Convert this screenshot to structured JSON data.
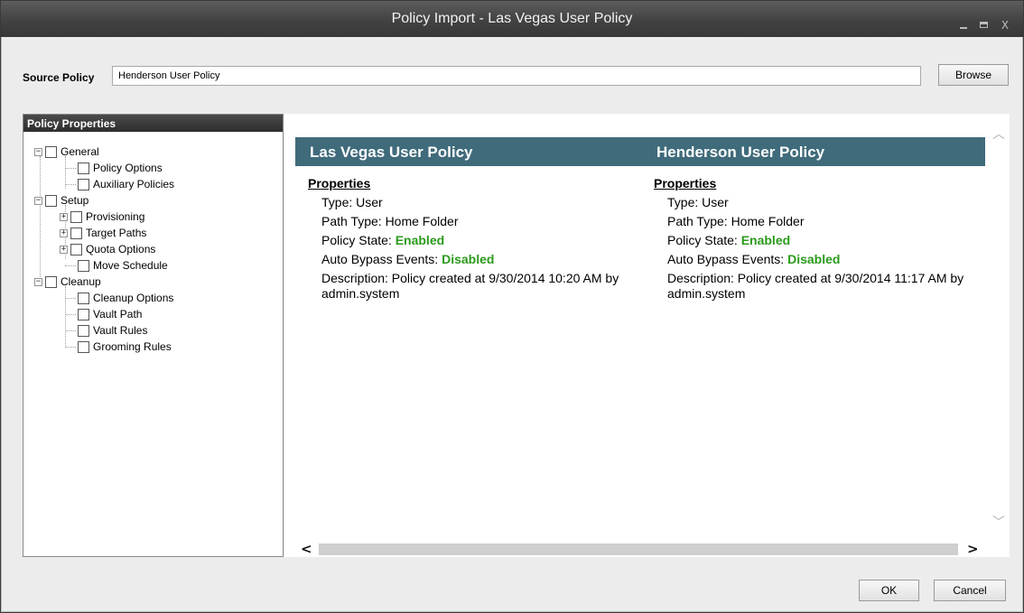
{
  "window": {
    "title": "Policy Import - Las Vegas User Policy",
    "controls": [
      "_",
      "□",
      "X"
    ]
  },
  "source": {
    "label": "Source Policy",
    "value": "Henderson User Policy",
    "browse_label": "Browse"
  },
  "tree": {
    "header": "Policy Properties",
    "nodes": [
      {
        "label": "General",
        "expander": "−"
      },
      {
        "label": "Policy Options"
      },
      {
        "label": "Auxiliary Policies"
      },
      {
        "label": "Setup",
        "expander": "−"
      },
      {
        "label": "Provisioning",
        "expander": "+"
      },
      {
        "label": "Target Paths",
        "expander": "+"
      },
      {
        "label": "Quota Options",
        "expander": "+"
      },
      {
        "label": "Move Schedule"
      },
      {
        "label": "Cleanup",
        "expander": "−"
      },
      {
        "label": "Cleanup Options"
      },
      {
        "label": "Vault Path"
      },
      {
        "label": "Vault Rules"
      },
      {
        "label": "Grooming Rules"
      }
    ]
  },
  "compare": {
    "left": {
      "title": "Las Vegas User Policy",
      "section": "Properties",
      "type": "Type: User",
      "path_type": "Path Type: Home Folder",
      "state_label": "Policy State: ",
      "state_value": "Enabled",
      "bypass_label": "Auto Bypass Events: ",
      "bypass_value": "Disabled",
      "description": "Description: Policy created at 9/30/2014 10:20 AM by admin.system"
    },
    "right": {
      "title": "Henderson User Policy",
      "section": "Properties",
      "type": "Type: User",
      "path_type": "Path Type: Home Folder",
      "state_label": "Policy State: ",
      "state_value": "Enabled",
      "bypass_label": "Auto Bypass Events: ",
      "bypass_value": "Disabled",
      "description": "Description: Policy created at 9/30/2014 11:17 AM by admin.system"
    }
  },
  "scroll": {
    "up": "︿",
    "down": "﹀",
    "left": "<",
    "right": ">"
  },
  "footer": {
    "ok_label": "OK",
    "cancel_label": "Cancel"
  },
  "colors": {
    "header_bg": "#3f6b7b",
    "status_green": "#2b9a1c"
  }
}
